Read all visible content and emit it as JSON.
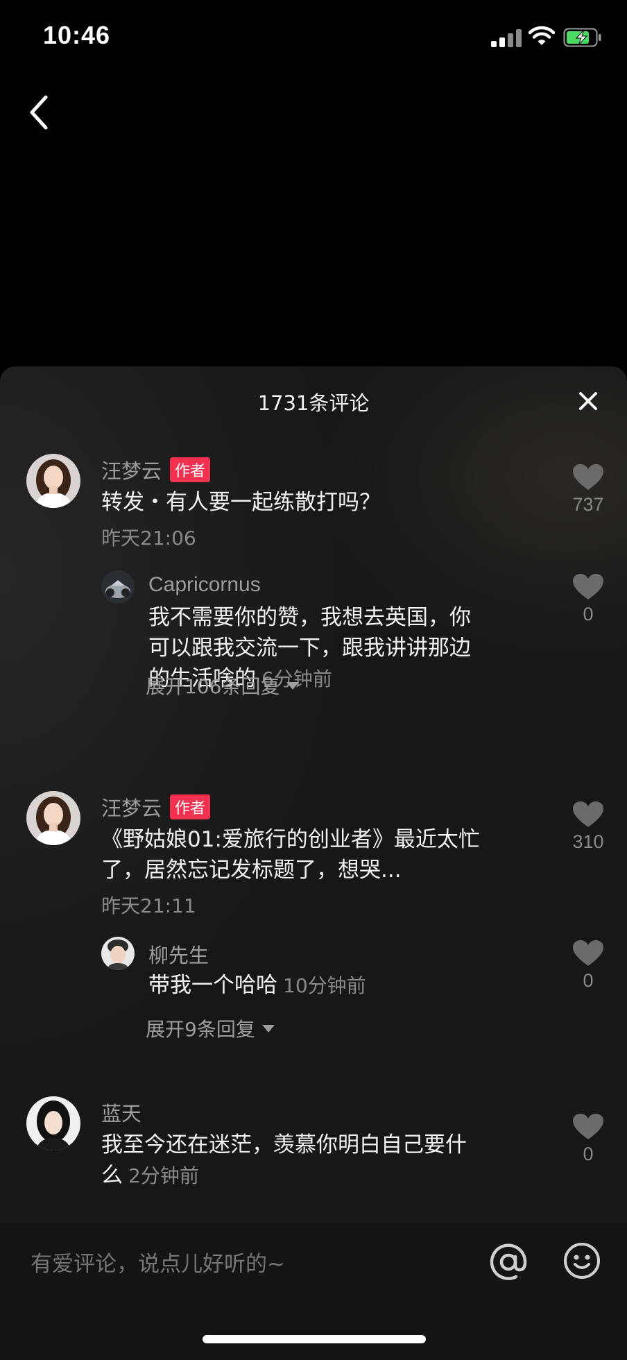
{
  "status_bar": {
    "time": "10:46",
    "battery": "charging"
  },
  "comments_panel": {
    "title": "1731条评论",
    "comments": [
      {
        "user": "汪梦云",
        "badge": "作者",
        "text": "转发・有人要一起练散打吗？",
        "date": "昨天21:06",
        "likes": "737",
        "reply": {
          "user": "Capricornus",
          "text": "我不需要你的赞，我想去英国，你可以跟我交流一下，跟我讲讲那边的生活啥的",
          "text_lines": [
            "我不需要你的赞，我想去英国，你",
            "可以跟我交流一下，跟我讲讲那边",
            "的生活啥的"
          ],
          "time": "6分钟前",
          "likes": "0"
        },
        "expand_label": "展开106条回复"
      },
      {
        "user": "汪梦云",
        "badge": "作者",
        "text": "《野姑娘01:爱旅行的创业者》最近太忙了，居然忘记发标题了，想哭...",
        "text_lines": [
          "《野姑娘01:爱旅行的创业者》最近太忙",
          "了，居然忘记发标题了，想哭..."
        ],
        "date": "昨天21:11",
        "likes": "310",
        "reply": {
          "user": "柳先生",
          "text": "带我一个哈哈",
          "time": "10分钟前",
          "likes": "0"
        },
        "expand_label": "展开9条回复"
      },
      {
        "user": "蓝天",
        "text": "我至今还在迷茫，羡慕你明白自己要什么",
        "text_lines": [
          "我至今还在迷茫，羡慕你明白自己要什",
          "么"
        ],
        "time": "2分钟前",
        "likes": "0"
      }
    ]
  },
  "input": {
    "placeholder": "有爱评论，说点儿好听的~"
  },
  "icons": {
    "back": "chevron-left-icon",
    "close": "close-icon",
    "like": "heart-icon",
    "mention": "at-sign-icon",
    "emoji": "smiley-icon"
  },
  "colors": {
    "badge": "#f1314f",
    "sheet_bg": "#171717",
    "muted_text": "#8a8a8a",
    "battery": "#4cd964"
  }
}
